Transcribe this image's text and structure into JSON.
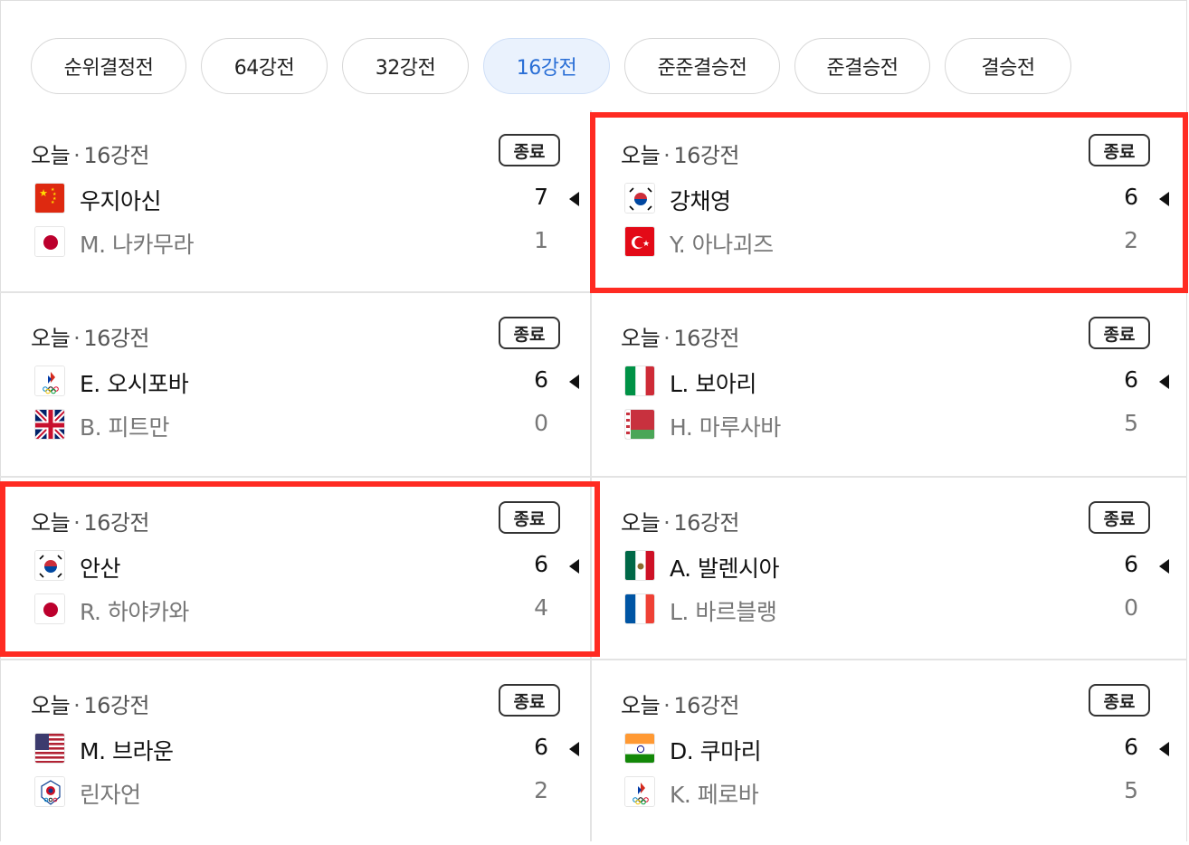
{
  "tabs": [
    {
      "label": "순위결정전",
      "active": false
    },
    {
      "label": "64강전",
      "active": false
    },
    {
      "label": "32강전",
      "active": false
    },
    {
      "label": "16강전",
      "active": true
    },
    {
      "label": "준준결승전",
      "active": false
    },
    {
      "label": "준결승전",
      "active": false
    },
    {
      "label": "결승전",
      "active": false
    }
  ],
  "matches": [
    {
      "day": "오늘",
      "round": "16강전",
      "status": "종료",
      "highlighted": false,
      "p1": {
        "name": "우지아신",
        "flag": "china-flag-icon",
        "score": "7",
        "winner": true
      },
      "p2": {
        "name": "M. 나카무라",
        "flag": "japan-flag-icon",
        "score": "1",
        "winner": false
      }
    },
    {
      "day": "오늘",
      "round": "16강전",
      "status": "종료",
      "highlighted": true,
      "p1": {
        "name": "강채영",
        "flag": "korea-flag-icon",
        "score": "6",
        "winner": true
      },
      "p2": {
        "name": "Y. 아나괴즈",
        "flag": "turkey-flag-icon",
        "score": "2",
        "winner": false
      }
    },
    {
      "day": "오늘",
      "round": "16강전",
      "status": "종료",
      "highlighted": false,
      "p1": {
        "name": "E. 오시포바",
        "flag": "roc-flag-icon",
        "score": "6",
        "winner": true
      },
      "p2": {
        "name": "B. 피트만",
        "flag": "uk-flag-icon",
        "score": "0",
        "winner": false
      }
    },
    {
      "day": "오늘",
      "round": "16강전",
      "status": "종료",
      "highlighted": false,
      "p1": {
        "name": "L. 보아리",
        "flag": "italy-flag-icon",
        "score": "6",
        "winner": true
      },
      "p2": {
        "name": "H. 마루사바",
        "flag": "belarus-flag-icon",
        "score": "5",
        "winner": false
      }
    },
    {
      "day": "오늘",
      "round": "16강전",
      "status": "종료",
      "highlighted": true,
      "p1": {
        "name": "안산",
        "flag": "korea-flag-icon",
        "score": "6",
        "winner": true
      },
      "p2": {
        "name": "R. 하야카와",
        "flag": "japan-flag-icon",
        "score": "4",
        "winner": false
      }
    },
    {
      "day": "오늘",
      "round": "16강전",
      "status": "종료",
      "highlighted": false,
      "p1": {
        "name": "A. 발렌시아",
        "flag": "mexico-flag-icon",
        "score": "6",
        "winner": true
      },
      "p2": {
        "name": "L. 바르블랭",
        "flag": "france-flag-icon",
        "score": "0",
        "winner": false
      }
    },
    {
      "day": "오늘",
      "round": "16강전",
      "status": "종료",
      "highlighted": false,
      "p1": {
        "name": "M. 브라운",
        "flag": "usa-flag-icon",
        "score": "6",
        "winner": true
      },
      "p2": {
        "name": "린자언",
        "flag": "chinese-taipei-flag-icon",
        "score": "2",
        "winner": false
      }
    },
    {
      "day": "오늘",
      "round": "16강전",
      "status": "종료",
      "highlighted": false,
      "p1": {
        "name": "D. 쿠마리",
        "flag": "india-flag-icon",
        "score": "6",
        "winner": true
      },
      "p2": {
        "name": "K. 페로바",
        "flag": "roc-flag-icon",
        "score": "5",
        "winner": false
      }
    }
  ],
  "colors": {
    "highlight": "#ff2b22",
    "active_tab_bg": "#eaf2fd",
    "active_tab_text": "#2a6fd6"
  }
}
